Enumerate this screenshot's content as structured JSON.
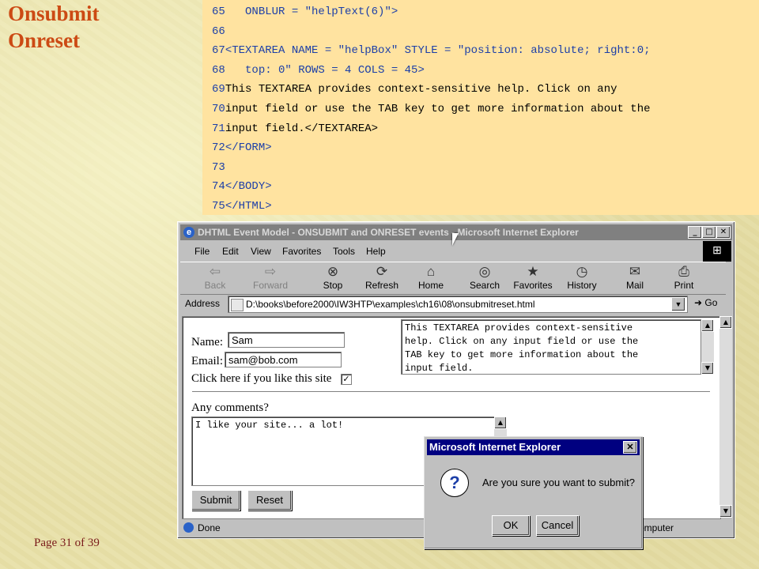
{
  "slide": {
    "title_line1": "Onsubmit",
    "title_line2": "Onreset",
    "page_number": "Page 31 of 39"
  },
  "code_lines": [
    {
      "num": "65",
      "text": "   ONBLUR = \"helpText(6)\">"
    },
    {
      "num": "66",
      "text": ""
    },
    {
      "num": "67",
      "text": "<TEXTAREA NAME = \"helpBox\" STYLE = \"position: absolute; right:0;"
    },
    {
      "num": "68",
      "text": "   top: 0\" ROWS = 4 COLS = 45>"
    },
    {
      "num": "69",
      "text": "This TEXTAREA provides context-sensitive help. Click on any"
    },
    {
      "num": "70",
      "text": "input field or use the TAB key to get more information about the"
    },
    {
      "num": "71",
      "text": "input field.</TEXTAREA>"
    },
    {
      "num": "72",
      "text": "</FORM>"
    },
    {
      "num": "73",
      "text": ""
    },
    {
      "num": "74",
      "text": "</BODY>"
    },
    {
      "num": "75",
      "text": "</HTML>"
    }
  ],
  "browser": {
    "window_title": "DHTML Event Model - ONSUBMIT and ONRESET events - Microsoft Internet Explorer",
    "menu": [
      "File",
      "Edit",
      "View",
      "Favorites",
      "Tools",
      "Help"
    ],
    "toolbar": {
      "back": "Back",
      "forward": "Forward",
      "stop": "Stop",
      "refresh": "Refresh",
      "home": "Home",
      "search": "Search",
      "favorites": "Favorites",
      "history": "History",
      "mail": "Mail",
      "print": "Print"
    },
    "address_label": "Address",
    "address_url": "D:\\books\\before2000\\IW3HTP\\examples\\ch16\\08\\onsubmitreset.html",
    "go_label": "Go",
    "status_text": "Done",
    "status_zone": "omputer"
  },
  "form": {
    "name_label": "Name:",
    "name_value": "Sam",
    "email_label": "Email:",
    "email_value": "sam@bob.com",
    "checkbox_label": "Click here if you like this site",
    "checkbox_checked": true,
    "comments_label": "Any comments?",
    "comments_value": "I like your site... a lot!",
    "help_text": "This TEXTAREA provides context-sensitive\nhelp. Click on any input field or use the\nTAB key to get more information about the\ninput field.",
    "submit_label": "Submit",
    "reset_label": "Reset"
  },
  "dialog": {
    "title": "Microsoft Internet Explorer",
    "message": "Are you sure you want to submit?",
    "ok_label": "OK",
    "cancel_label": "Cancel"
  }
}
